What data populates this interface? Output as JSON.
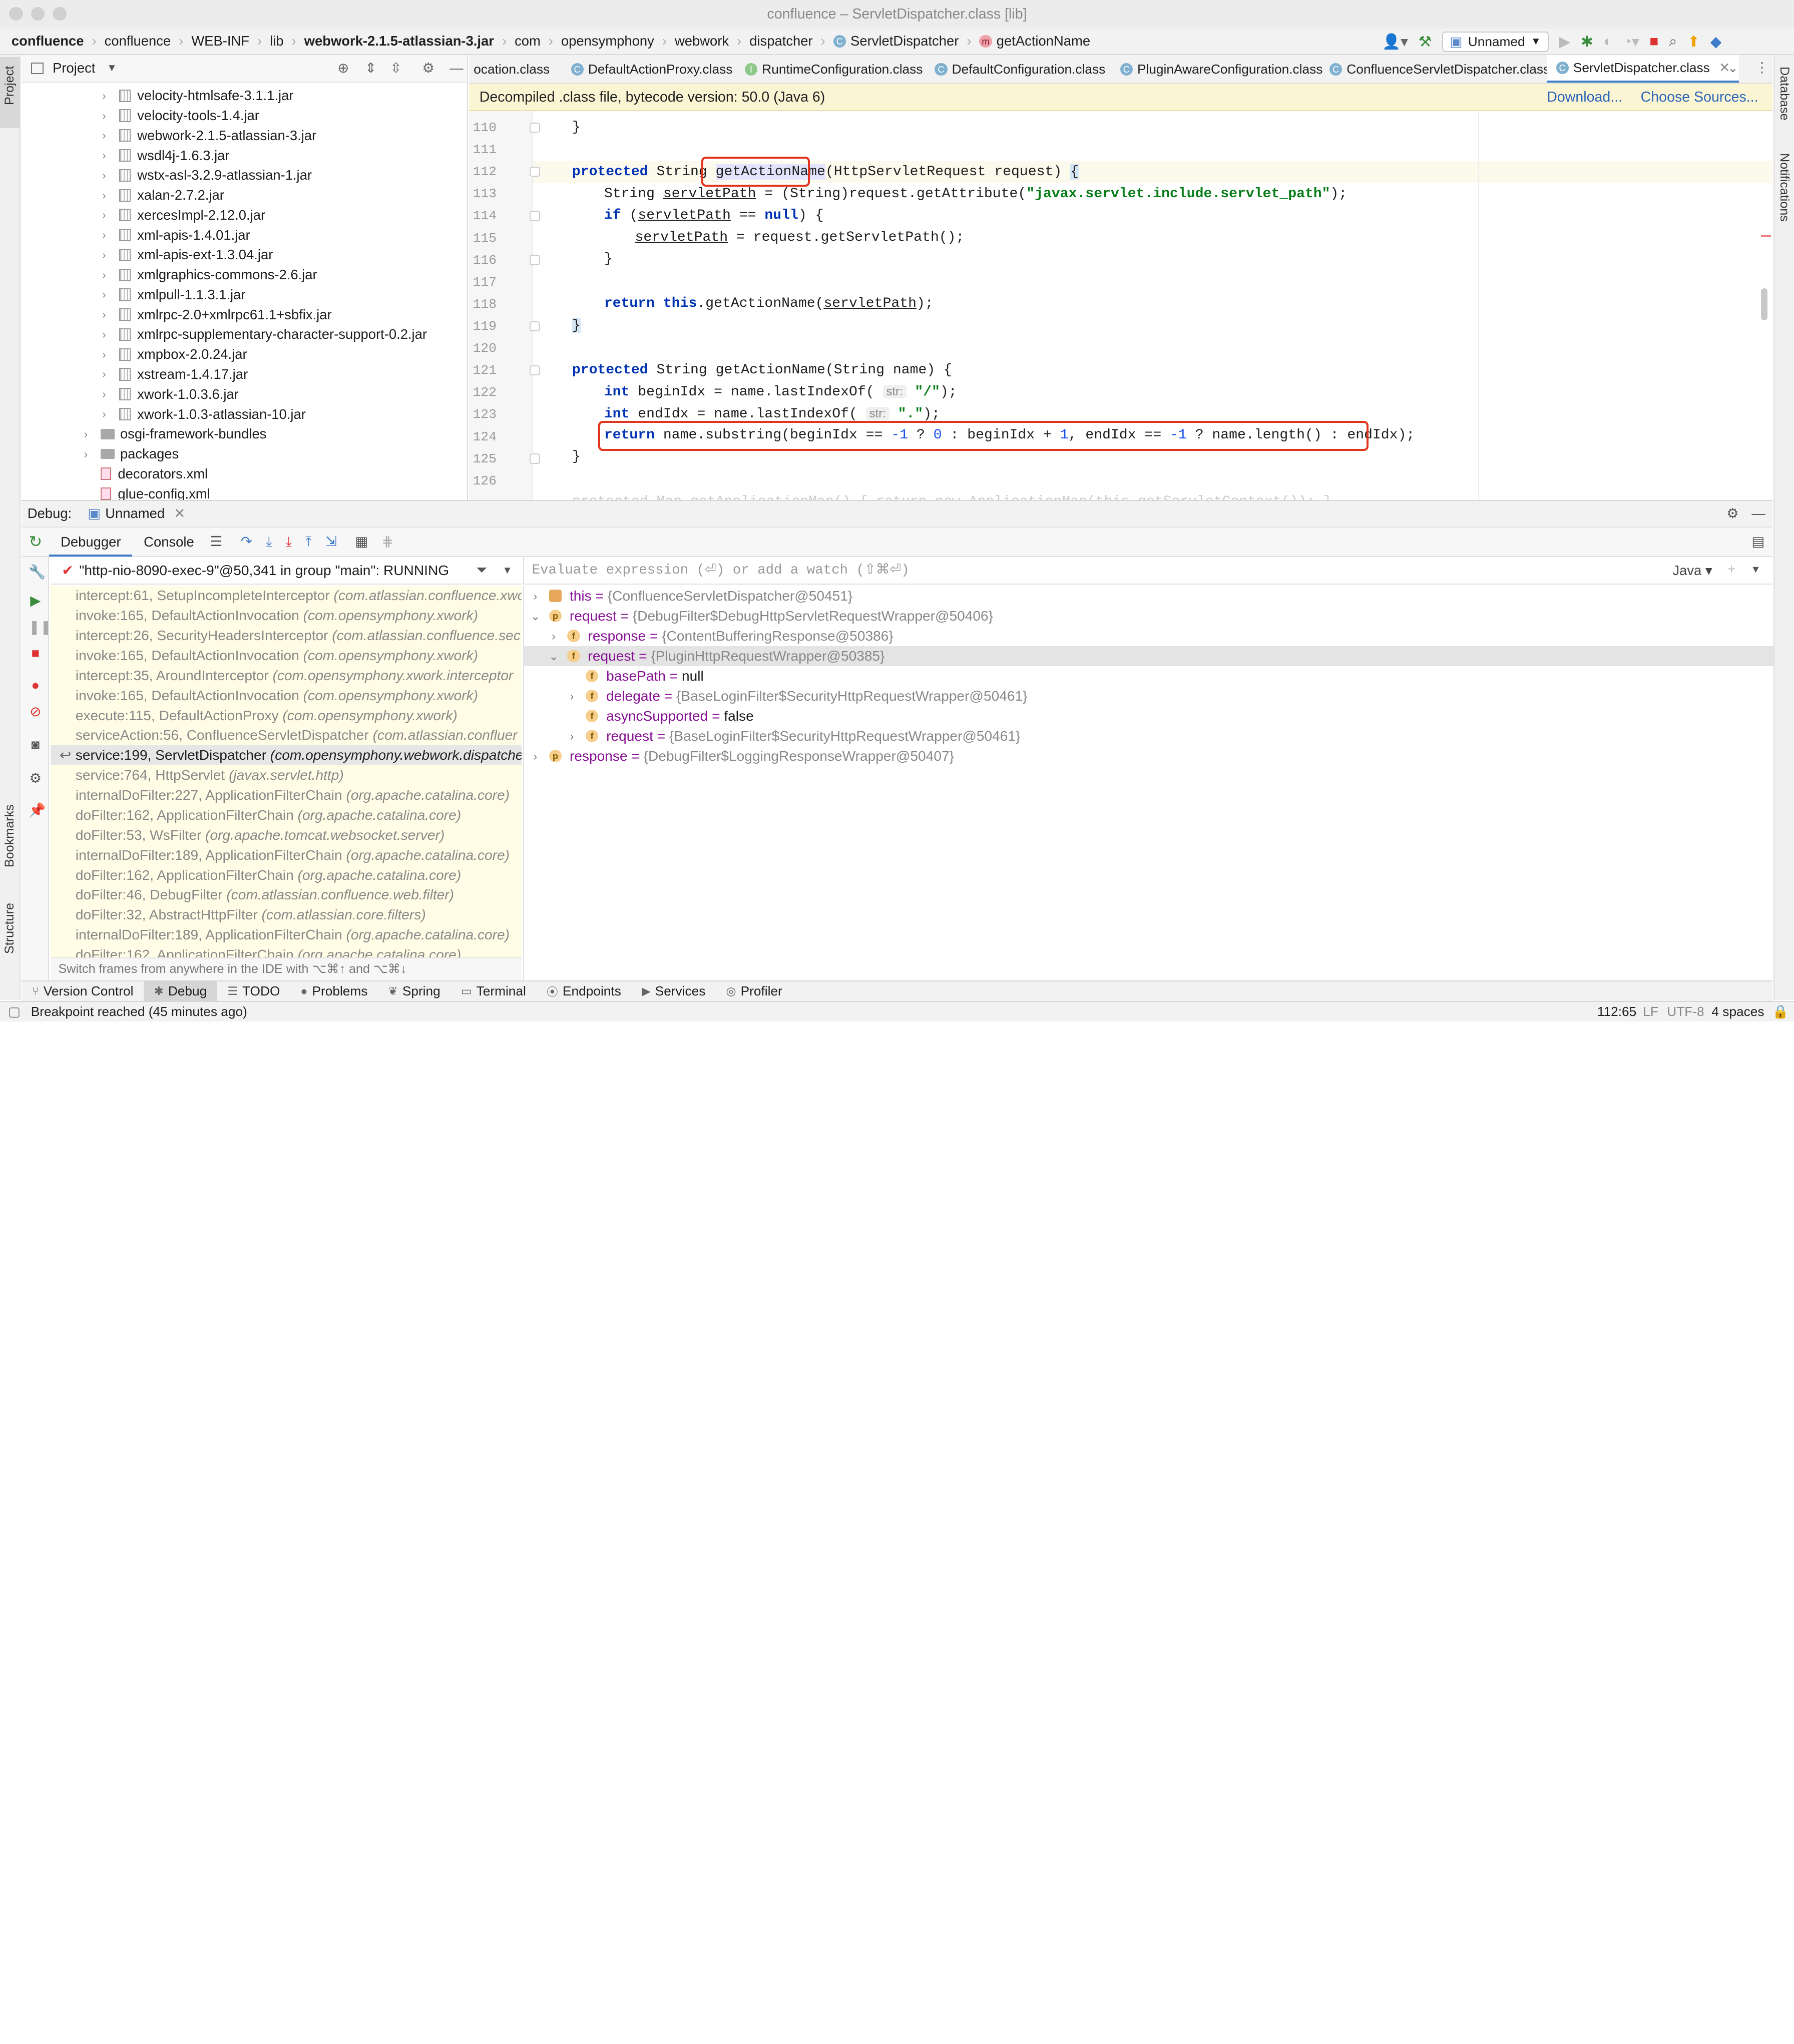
{
  "window": {
    "title": "confluence – ServletDispatcher.class [lib]"
  },
  "breadcrumb": [
    "confluence",
    "confluence",
    "WEB-INF",
    "lib",
    "webwork-2.1.5-atlassian-3.jar",
    "com",
    "opensymphony",
    "webwork",
    "dispatcher",
    "ServletDispatcher",
    "getActionName"
  ],
  "toolbar": {
    "run_config": "Unnamed"
  },
  "project": {
    "title": "Project",
    "items": [
      "velocity-htmlsafe-3.1.1.jar",
      "velocity-tools-1.4.jar",
      "webwork-2.1.5-atlassian-3.jar",
      "wsdl4j-1.6.3.jar",
      "wstx-asl-3.2.9-atlassian-1.jar",
      "xalan-2.7.2.jar",
      "xercesImpl-2.12.0.jar",
      "xml-apis-1.4.01.jar",
      "xml-apis-ext-1.3.04.jar",
      "xmlgraphics-commons-2.6.jar",
      "xmlpull-1.1.3.1.jar",
      "xmlrpc-2.0+xmlrpc61.1+sbfix.jar",
      "xmlrpc-supplementary-character-support-0.2.jar",
      "xmpbox-2.0.24.jar",
      "xstream-1.4.17.jar",
      "xwork-1.0.3.6.jar",
      "xwork-1.0.3-atlassian-10.jar"
    ],
    "folders": [
      "osgi-framework-bundles",
      "packages"
    ],
    "files": [
      "decorators.xml",
      "glue-config.xml"
    ]
  },
  "tabs": [
    "ocation.class",
    "DefaultActionProxy.class",
    "RuntimeConfiguration.class",
    "DefaultConfiguration.class",
    "PluginAwareConfiguration.class",
    "ConfluenceServletDispatcher.class",
    "ServletDispatcher.class"
  ],
  "banner": {
    "text": "Decompiled .class file, bytecode version: 50.0 (Java 6)",
    "download": "Download...",
    "sources": "Choose Sources..."
  },
  "editor": {
    "line_numbers": [
      "110",
      "111",
      "112",
      "113",
      "114",
      "115",
      "116",
      "117",
      "118",
      "119",
      "120",
      "121",
      "122",
      "123",
      "124",
      "125",
      "126"
    ],
    "hint_label": "str:"
  },
  "debug": {
    "label": "Debug:",
    "config": "Unnamed",
    "tabs": [
      "Debugger",
      "Console"
    ],
    "thread": "\"http-nio-8090-exec-9\"@50,341 in group \"main\": RUNNING",
    "frames": [
      {
        "method": "intercept:61, SetupIncompleteInterceptor",
        "pkg": "(com.atlassian.confluence.xwork"
      },
      {
        "method": "invoke:165, DefaultActionInvocation",
        "pkg": "(com.opensymphony.xwork)"
      },
      {
        "method": "intercept:26, SecurityHeadersInterceptor",
        "pkg": "(com.atlassian.confluence.sec"
      },
      {
        "method": "invoke:165, DefaultActionInvocation",
        "pkg": "(com.opensymphony.xwork)"
      },
      {
        "method": "intercept:35, AroundInterceptor",
        "pkg": "(com.opensymphony.xwork.interceptor"
      },
      {
        "method": "invoke:165, DefaultActionInvocation",
        "pkg": "(com.opensymphony.xwork)"
      },
      {
        "method": "execute:115, DefaultActionProxy",
        "pkg": "(com.opensymphony.xwork)"
      },
      {
        "method": "serviceAction:56, ConfluenceServletDispatcher",
        "pkg": "(com.atlassian.confluer"
      },
      {
        "method": "service:199, ServletDispatcher",
        "pkg": "(com.opensymphony.webwork.dispatche"
      },
      {
        "method": "service:764, HttpServlet",
        "pkg": "(javax.servlet.http)"
      },
      {
        "method": "internalDoFilter:227, ApplicationFilterChain",
        "pkg": "(org.apache.catalina.core)"
      },
      {
        "method": "doFilter:162, ApplicationFilterChain",
        "pkg": "(org.apache.catalina.core)"
      },
      {
        "method": "doFilter:53, WsFilter",
        "pkg": "(org.apache.tomcat.websocket.server)"
      },
      {
        "method": "internalDoFilter:189, ApplicationFilterChain",
        "pkg": "(org.apache.catalina.core)"
      },
      {
        "method": "doFilter:162, ApplicationFilterChain",
        "pkg": "(org.apache.catalina.core)"
      },
      {
        "method": "doFilter:46, DebugFilter",
        "pkg": "(com.atlassian.confluence.web.filter)"
      },
      {
        "method": "doFilter:32, AbstractHttpFilter",
        "pkg": "(com.atlassian.core.filters)"
      },
      {
        "method": "internalDoFilter:189, ApplicationFilterChain",
        "pkg": "(org.apache.catalina.core)"
      },
      {
        "method": "doFilter:162, ApplicationFilterChain",
        "pkg": "(org.apache.catalina.core)"
      }
    ],
    "frames_hint": "Switch frames from anywhere in the IDE with ⌥⌘↑ and ⌥⌘↓",
    "eval_placeholder": "Evaluate expression (⏎) or add a watch (⇧⌘⏎)",
    "eval_lang": "Java",
    "variables": [
      {
        "name": "this",
        "value": "{ConfluenceServletDispatcher@50451}"
      },
      {
        "name": "request",
        "value": "{DebugFilter$DebugHttpServletRequestWrapper@50406}"
      },
      {
        "name": "response",
        "value": "{ContentBufferingResponse@50386}"
      },
      {
        "name": "request",
        "value": "{PluginHttpRequestWrapper@50385}"
      },
      {
        "name": "basePath",
        "value": "null"
      },
      {
        "name": "delegate",
        "value": "{BaseLoginFilter$SecurityHttpRequestWrapper@50461}"
      },
      {
        "name": "asyncSupported",
        "value": "false"
      },
      {
        "name": "request",
        "value": "{BaseLoginFilter$SecurityHttpRequestWrapper@50461}"
      },
      {
        "name": "response",
        "value": "{DebugFilter$LoggingResponseWrapper@50407}"
      }
    ]
  },
  "bottom_tools": [
    "Version Control",
    "Debug",
    "TODO",
    "Problems",
    "Spring",
    "Terminal",
    "Endpoints",
    "Services",
    "Profiler"
  ],
  "status": {
    "message": "Breakpoint reached (45 minutes ago)",
    "position": "112:65",
    "line_sep": "LF",
    "encoding": "UTF-8",
    "indent": "4 spaces"
  },
  "side_strips": {
    "left": [
      "Project",
      "Bookmarks",
      "Structure"
    ],
    "right": [
      "Database",
      "Notifications"
    ]
  },
  "colors": {
    "accent": "#3d7cc9",
    "highlight_box": "#e0341e",
    "banner_bg": "#fbf5d4",
    "frames_bg": "#fffde6"
  }
}
